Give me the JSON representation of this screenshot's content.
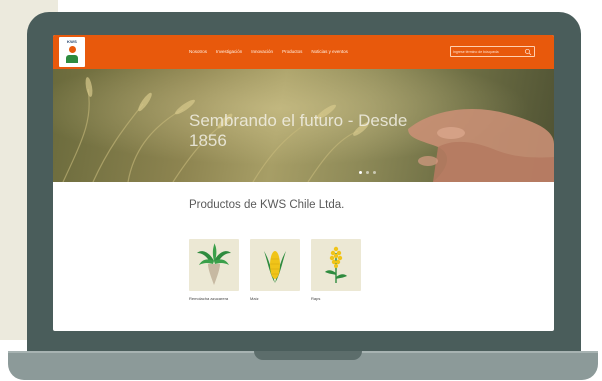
{
  "site": {
    "logo_text": "KWS",
    "nav": [
      "Nosotros",
      "Investigación",
      "Innovación",
      "Productos",
      "Noticias y eventos"
    ],
    "search_placeholder": "Ingrese término de búsqueda"
  },
  "hero": {
    "title": "Sembrando el futuro - Desde 1856",
    "slide_count": 3,
    "active_slide": 0
  },
  "products": {
    "title": "Productos de KWS Chile Ltda.",
    "items": [
      {
        "label": "Remolacha azucarera",
        "icon": "sugar-beet-icon"
      },
      {
        "label": "Maíz",
        "icon": "corn-icon"
      },
      {
        "label": "Raps",
        "icon": "rapeseed-icon"
      }
    ]
  },
  "colors": {
    "header": "#e8590c",
    "laptop_frame": "#4a5d5b",
    "laptop_base": "#8c9a99",
    "product_tile": "#ece8d4",
    "background_panel": "#eceadd"
  }
}
